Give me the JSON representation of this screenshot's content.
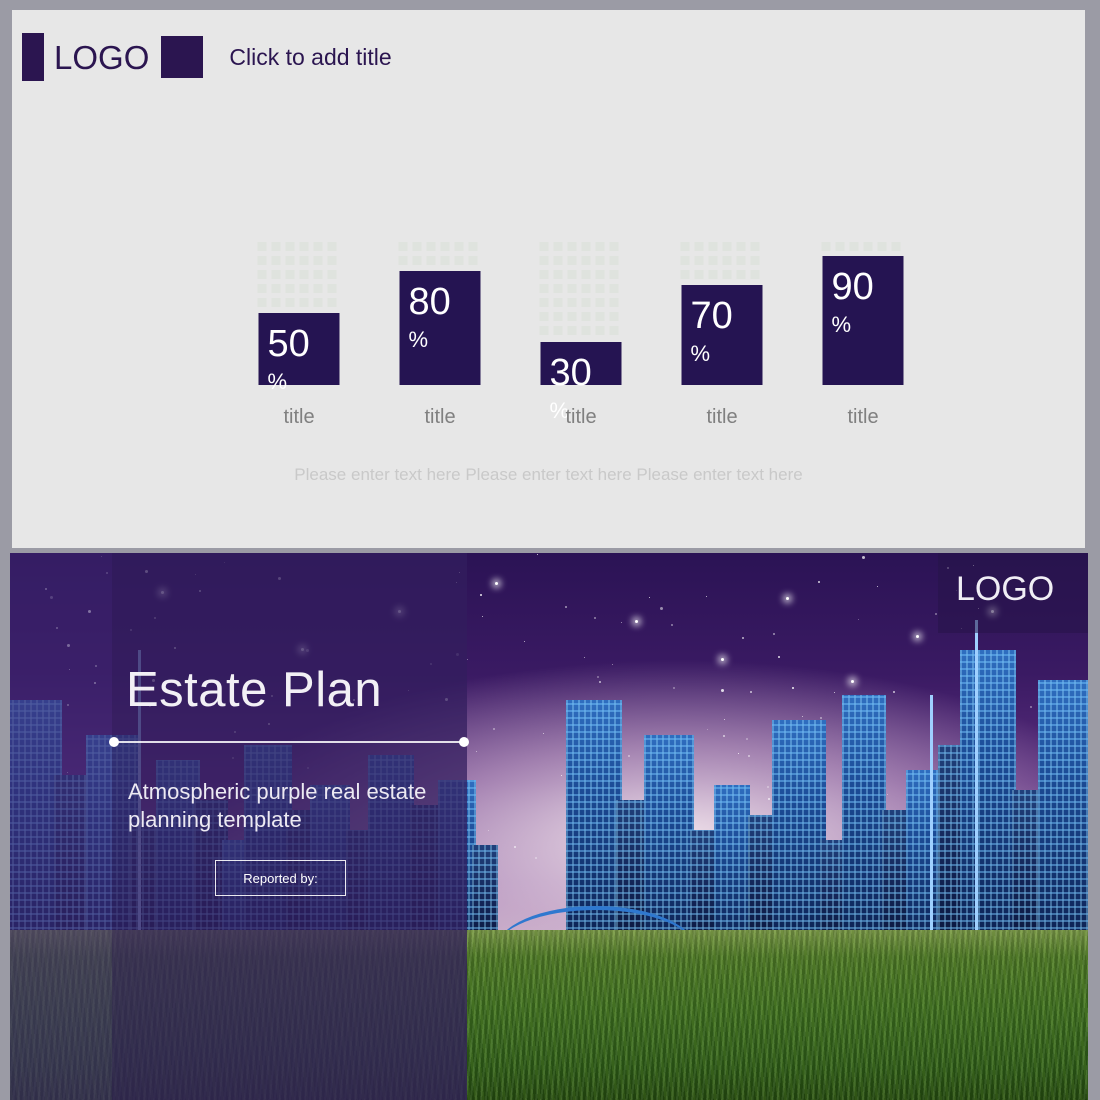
{
  "top_slide": {
    "logo_text": "LOGO",
    "title": "Click to add title",
    "caption": "Please enter text here Please enter text here Please enter text here"
  },
  "chart_data": {
    "type": "bar",
    "title": "",
    "xlabel": "",
    "ylabel": "",
    "ylim": [
      0,
      100
    ],
    "unit": "%",
    "grid": false,
    "legend": "none",
    "categories": [
      "title",
      "title",
      "title",
      "title",
      "title"
    ],
    "values": [
      50,
      80,
      30,
      70,
      90
    ],
    "value_labels": [
      "50",
      "80",
      "30",
      "70",
      "90"
    ],
    "bar_color": "#251452",
    "placeholder_dot_color": "#dfe3de",
    "series": [
      {
        "name": "percent",
        "values": [
          50,
          80,
          30,
          70,
          90
        ]
      }
    ]
  },
  "bottom_slide": {
    "title": "Estate Plan",
    "subtitle": "Atmospheric purple real estate planning template",
    "reported_label": "Reported by:",
    "logo_text": "LOGO"
  },
  "colors": {
    "accent": "#2b1550",
    "bar": "#251452",
    "slide_bg": "#e7e7e7",
    "page_bg": "#9b9ba5",
    "muted_text": "#808080",
    "caption_text": "#c9c9c9"
  }
}
